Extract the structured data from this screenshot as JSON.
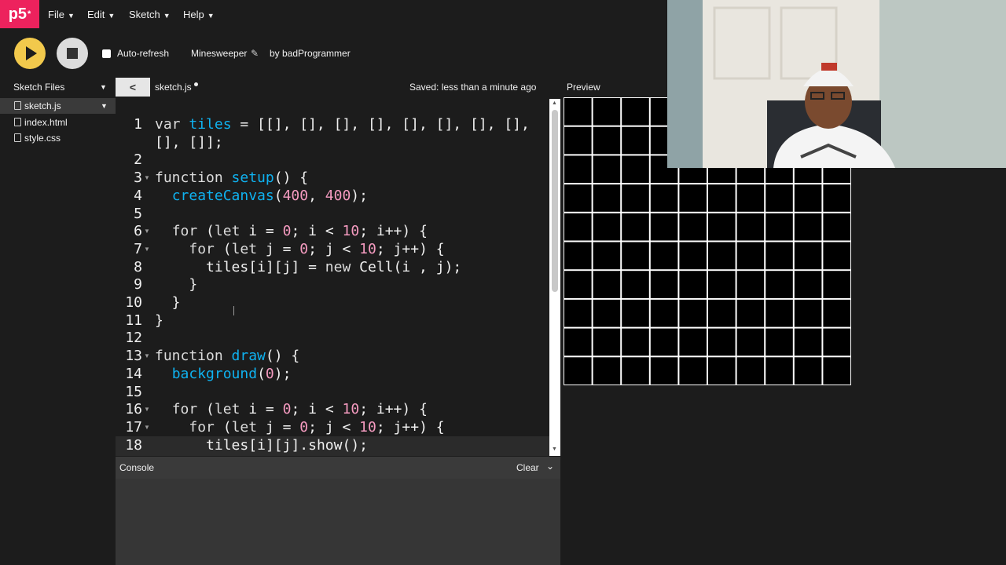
{
  "app": {
    "logo": "p5",
    "logo_mark": "*"
  },
  "menu": {
    "items": [
      {
        "label": "File"
      },
      {
        "label": "Edit"
      },
      {
        "label": "Sketch"
      },
      {
        "label": "Help"
      }
    ]
  },
  "toolbar": {
    "play": "play",
    "stop": "stop",
    "auto_refresh_label": "Auto-refresh",
    "auto_refresh_checked": false,
    "sketch_name": "Minesweeper",
    "owner": "by badProgrammer"
  },
  "sidebar": {
    "header": "Sketch Files",
    "files": [
      {
        "name": "sketch.js",
        "active": true
      },
      {
        "name": "index.html",
        "active": false
      },
      {
        "name": "style.css",
        "active": false
      }
    ]
  },
  "editor": {
    "tab_name": "sketch.js",
    "unsaved": true,
    "saved_status": "Saved: less than a minute ago",
    "active_line": 18,
    "lines": [
      {
        "num": "1",
        "text": "var tiles = [[], [], [], [], [], [], [], [],"
      },
      {
        "num": "",
        "text": "[], []];"
      },
      {
        "num": "2",
        "text": ""
      },
      {
        "num": "3",
        "text": "function setup() {"
      },
      {
        "num": "4",
        "text": "  createCanvas(400, 400);"
      },
      {
        "num": "5",
        "text": ""
      },
      {
        "num": "6",
        "text": "  for (let i = 0; i < 10; i++) {"
      },
      {
        "num": "7",
        "text": "    for (let j = 0; j < 10; j++) {"
      },
      {
        "num": "8",
        "text": "      tiles[i][j] = new Cell(i , j);"
      },
      {
        "num": "9",
        "text": "    }"
      },
      {
        "num": "10",
        "text": "  }"
      },
      {
        "num": "11",
        "text": "}"
      },
      {
        "num": "12",
        "text": ""
      },
      {
        "num": "13",
        "text": "function draw() {"
      },
      {
        "num": "14",
        "text": "  background(0);"
      },
      {
        "num": "15",
        "text": ""
      },
      {
        "num": "16",
        "text": "  for (let i = 0; i < 10; i++) {"
      },
      {
        "num": "17",
        "text": "    for (let j = 0; j < 10; j++) {"
      },
      {
        "num": "18",
        "text": "      tiles[i][j].show();"
      }
    ]
  },
  "preview": {
    "label": "Preview",
    "grid_rows": 10,
    "grid_cols": 10,
    "cell_fill": "#000000",
    "cell_stroke": "#ffffff"
  },
  "console": {
    "title": "Console",
    "clear_label": "Clear"
  },
  "colors": {
    "background": "#1c1c1c",
    "accent": "#ed225d",
    "play": "#f2c94c",
    "keyword": "#dcdcdc",
    "function": "#0fb2f0",
    "number": "#f59bc0"
  }
}
